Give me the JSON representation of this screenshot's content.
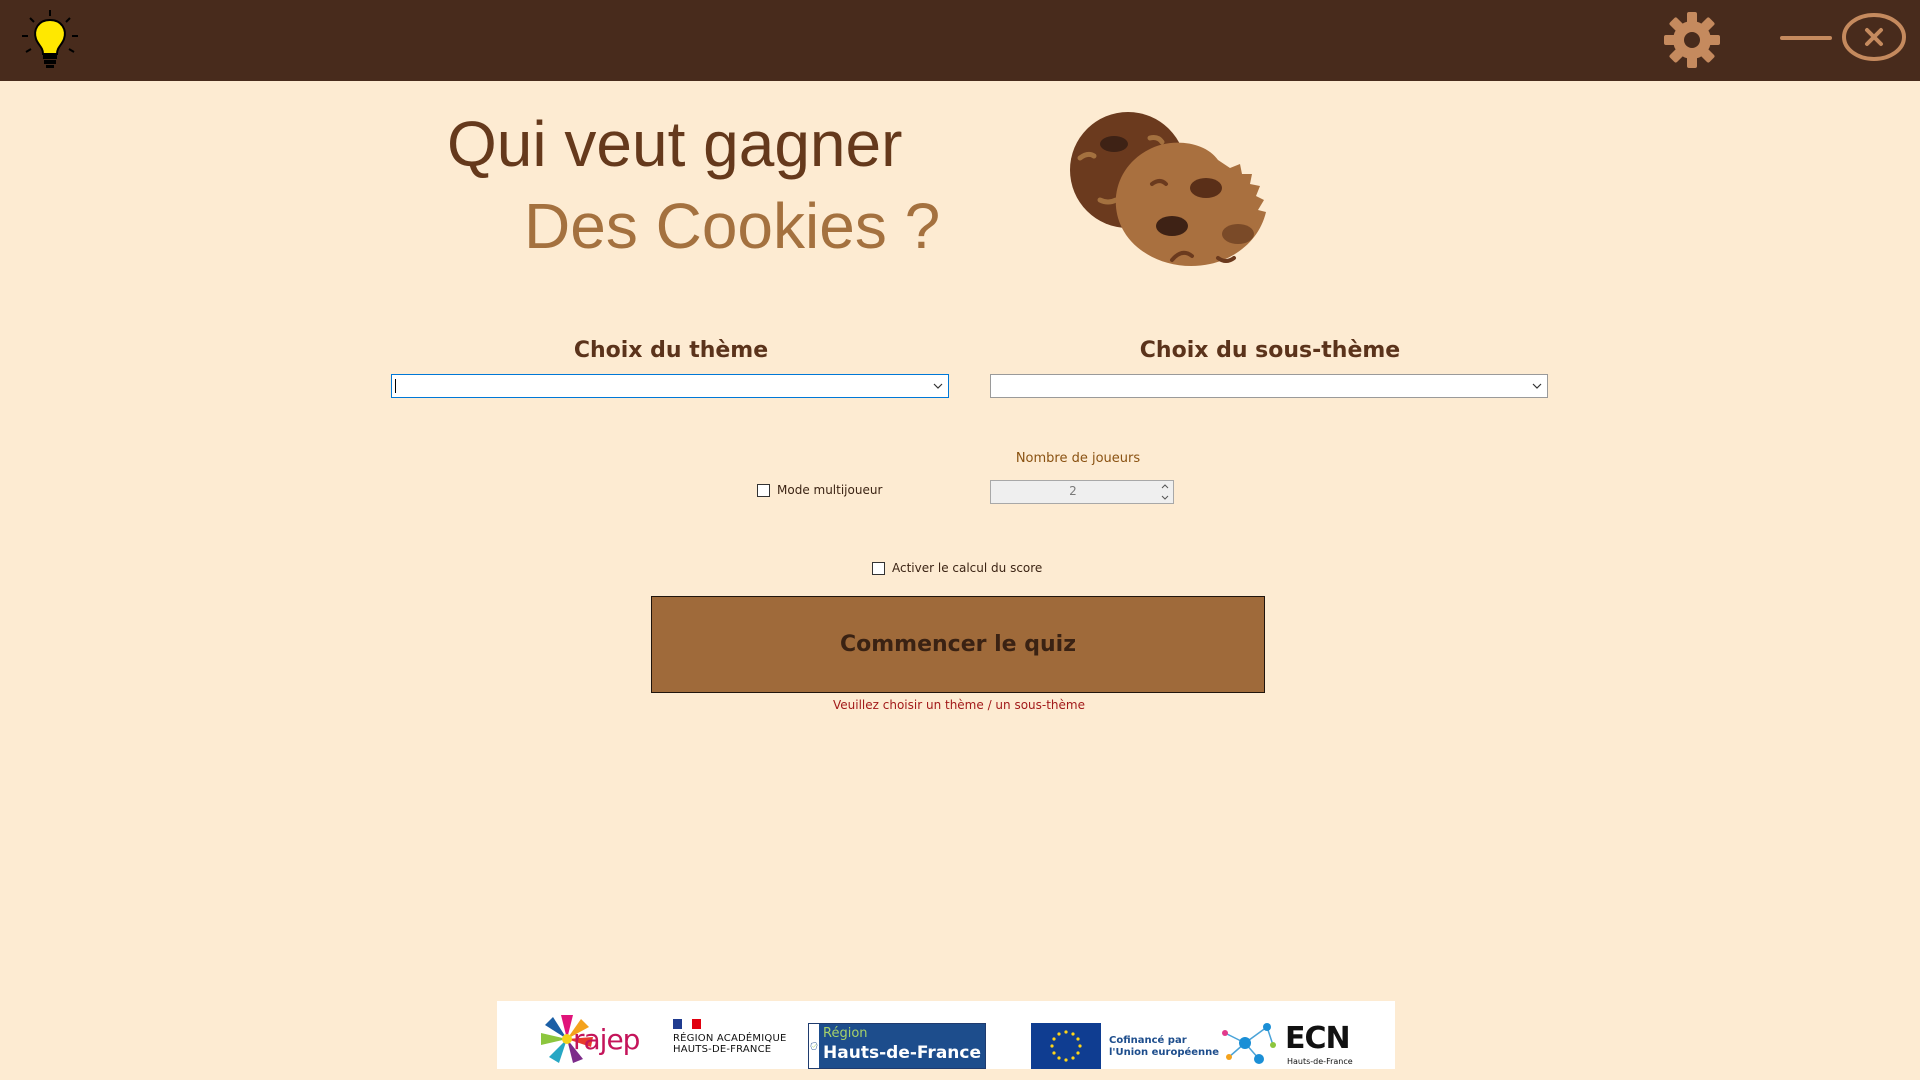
{
  "topbar": {
    "icons": [
      "lightbulb-icon",
      "gear-icon",
      "minimize-icon",
      "close-icon"
    ],
    "background_color": "#482b1c",
    "icon_color": "#c58a5e",
    "bulb_color": "#ffe800"
  },
  "header": {
    "title_line1": "Qui veut gagner",
    "title_line2": "Des Cookies ?",
    "title_line1_color": "#65391c",
    "title_line2_color": "#a4713f",
    "illustration": "cookies-icon"
  },
  "selectors": {
    "theme": {
      "label": "Choix du thème",
      "value": ""
    },
    "subtheme": {
      "label": "Choix du sous-thème",
      "value": ""
    }
  },
  "multiplayer": {
    "checkbox_label": "Mode multijoueur",
    "checked": false,
    "players_label": "Nombre de joueurs",
    "players_value": "2"
  },
  "score": {
    "checkbox_label": "Activer le calcul du score",
    "checked": false
  },
  "start": {
    "button_label": "Commencer le quiz",
    "button_color": "#9f6a3a",
    "warning": "Veuillez choisir un thème / un sous-thème",
    "warning_color": "#a21a1a"
  },
  "footer": {
    "logos": {
      "crajep": "rajep",
      "region_academique_line1": "RÉGION ACADÉMIQUE",
      "region_academique_line2": "HAUTS-DE-FRANCE",
      "hdf_small": "Région",
      "hdf_big": "Hauts-de-France",
      "eu_line1": "Cofinancé par",
      "eu_line2": "l'Union européenne",
      "ecn": "ECN",
      "ecn_sub": "Hauts-de-France"
    }
  },
  "background_color": "#fdebd2"
}
